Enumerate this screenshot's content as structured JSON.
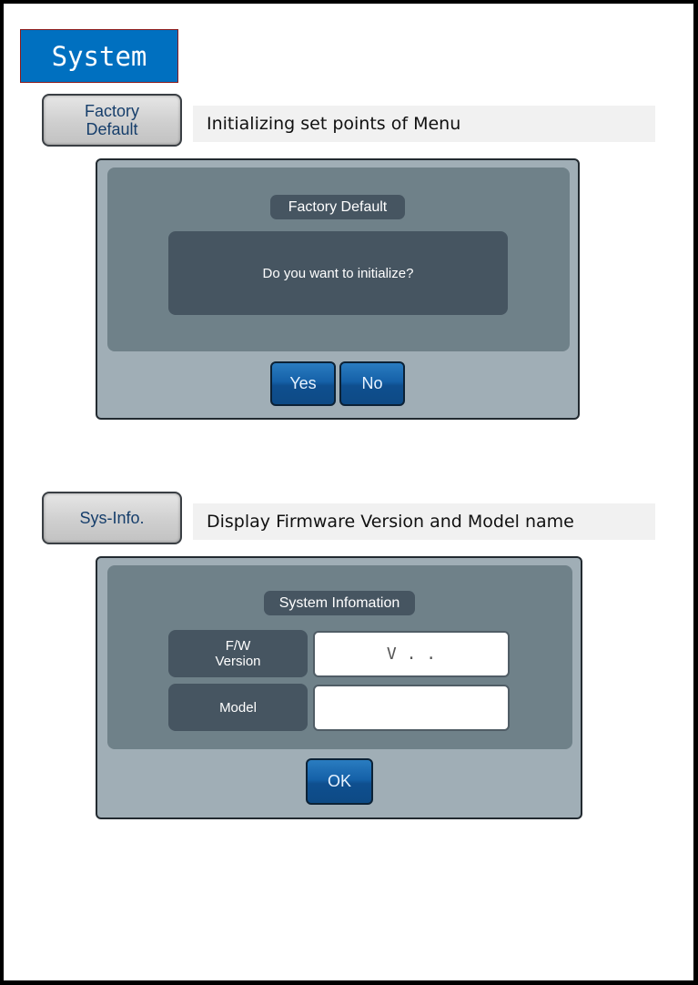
{
  "header": {
    "title": "System"
  },
  "sections": [
    {
      "button_label_line1": "Factory",
      "button_label_line2": "Default",
      "description": "Initializing set points of Menu",
      "dialog": {
        "title": "Factory Default",
        "message": "Do you want to initialize?",
        "buttons": [
          "Yes",
          "No"
        ]
      }
    },
    {
      "button_label": "Sys-Info.",
      "description": "Display Firmware Version and Model name",
      "dialog": {
        "title": "System Infomation",
        "rows": [
          {
            "label_line1": "F/W",
            "label_line2": "Version",
            "value": "V . ."
          },
          {
            "label": "Model",
            "value": ""
          }
        ],
        "ok_label": "OK"
      }
    }
  ],
  "colors": {
    "title_bg": "#0070c0",
    "dialog_frame": "#a0aeb6",
    "dialog_inner": "#6f8189",
    "dark_cell": "#465561",
    "button_blue": "#1561a8"
  }
}
